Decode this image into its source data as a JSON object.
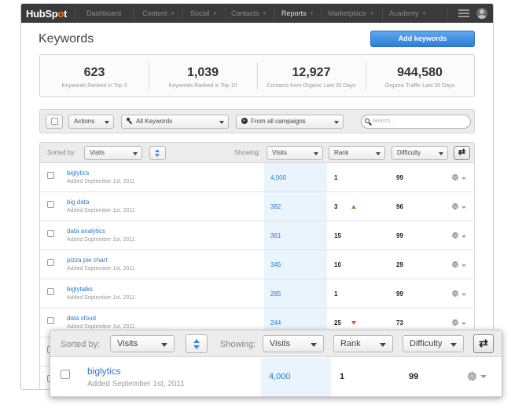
{
  "nav": {
    "logo_prefix": "HubSp",
    "logo_accent": "o",
    "logo_suffix": "t",
    "items": [
      {
        "label": "Dashboard"
      },
      {
        "label": "Content"
      },
      {
        "label": "Social"
      },
      {
        "label": "Contacts"
      },
      {
        "label": "Reports"
      },
      {
        "label": "Marketplace"
      },
      {
        "label": "Academy"
      }
    ],
    "active": "Reports"
  },
  "page": {
    "title": "Keywords",
    "add_button": "Add keywords"
  },
  "stats": [
    {
      "value": "623",
      "label": "Keywords Ranked in Top 3"
    },
    {
      "value": "1,039",
      "label": "Keywords Ranked in Top 10"
    },
    {
      "value": "12,927",
      "label": "Contacts from Organic Last 30 Days"
    },
    {
      "value": "944,580",
      "label": "Organic Traffic Last 30 Days"
    }
  ],
  "toolbar": {
    "actions": "Actions",
    "keywords_filter": "All Keywords",
    "campaign_filter": "From all campaigns",
    "search_placeholder": "Search..."
  },
  "table_header": {
    "sorted_by_label": "Sorted by:",
    "sorted_by_value": "Visits",
    "showing_label": "Showing:",
    "col1": "Visits",
    "col2": "Rank",
    "col3": "Difficulty"
  },
  "rows": [
    {
      "keyword": "biglytics",
      "added": "Added September 1st, 2011",
      "visits": "4,000",
      "rank": "1",
      "trend": "",
      "difficulty": "99"
    },
    {
      "keyword": "big data",
      "added": "Added September 1st, 2011",
      "visits": "382",
      "rank": "3",
      "trend": "up",
      "difficulty": "96"
    },
    {
      "keyword": "data analytics",
      "added": "Added September 1st, 2011",
      "visits": "361",
      "rank": "15",
      "trend": "",
      "difficulty": "99"
    },
    {
      "keyword": "pizza pie chart",
      "added": "Added September 1st, 2011",
      "visits": "345",
      "rank": "10",
      "trend": "",
      "difficulty": "29"
    },
    {
      "keyword": "biglytalks",
      "added": "Added September 1st, 2011",
      "visits": "285",
      "rank": "1",
      "trend": "",
      "difficulty": "99"
    },
    {
      "keyword": "data cloud",
      "added": "Added September 1st, 2011",
      "visits": "244",
      "rank": "25",
      "trend": "down",
      "difficulty": "73"
    }
  ],
  "zoom": {
    "sorted_by_label": "Sorted by:",
    "sorted_by_value": "Visits",
    "showing_label": "Showing:",
    "col1": "Visits",
    "col2": "Rank",
    "col3": "Difficulty",
    "row": {
      "keyword": "biglytics",
      "added": "Added September 1st, 2011",
      "visits": "4,000",
      "rank": "1",
      "difficulty": "99"
    }
  },
  "colors": {
    "nav_bg": "#3a3a3a",
    "logo_accent": "#f57722",
    "primary_button": "#2f7fd6",
    "link": "#2a7ad0",
    "trend_up": "#5aaa3a",
    "trend_down": "#d8572a",
    "highlight_column": "#eaf4fc"
  },
  "icons": [
    "menu-icon",
    "user-icon",
    "wrench-icon",
    "globe-icon",
    "search-icon",
    "sort-stepper-icon",
    "swap-columns-icon",
    "gear-icon",
    "chevron-down-icon"
  ]
}
